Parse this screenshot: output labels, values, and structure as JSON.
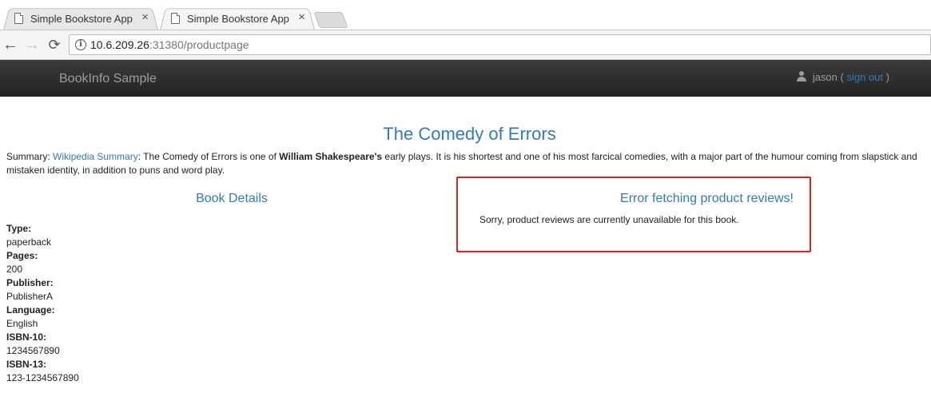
{
  "browser": {
    "tabs": [
      {
        "title": "Simple Bookstore App",
        "active": false
      },
      {
        "title": "Simple Bookstore App",
        "active": true
      }
    ],
    "close_glyph": "×",
    "back_glyph": "←",
    "forward_glyph": "→",
    "reload_glyph": "⟳",
    "info_glyph": "i",
    "url": {
      "host": "10.6.209.26",
      "rest": ":31380/productpage"
    }
  },
  "navbar": {
    "brand": "BookInfo Sample",
    "user": "jason",
    "open_paren": "(",
    "sign_out": "sign out",
    "close_paren": ")"
  },
  "product": {
    "title": "The Comedy of Errors",
    "summary_label": "Summary:",
    "summary_link": "Wikipedia Summary",
    "summary_text_1": ": The Comedy of Errors is one of ",
    "summary_bold": "William Shakespeare's",
    "summary_text_2": " early plays. It is his shortest and one of his most farcical comedies, with a major part of the humour coming from slapstick and mistaken identity, in addition to puns and word play."
  },
  "details": {
    "heading": "Book Details",
    "fields": [
      {
        "label": "Type:",
        "value": "paperback"
      },
      {
        "label": "Pages:",
        "value": "200"
      },
      {
        "label": "Publisher:",
        "value": "PublisherA"
      },
      {
        "label": "Language:",
        "value": "English"
      },
      {
        "label": "ISBN-10:",
        "value": "1234567890"
      },
      {
        "label": "ISBN-13:",
        "value": "123-1234567890"
      }
    ]
  },
  "reviews": {
    "error_title": "Error fetching product reviews!",
    "error_message": "Sorry, product reviews are currently unavailable for this book."
  },
  "colors": {
    "link": "#337ab7",
    "navbar": "#222222",
    "highlight": "#e0201f"
  }
}
